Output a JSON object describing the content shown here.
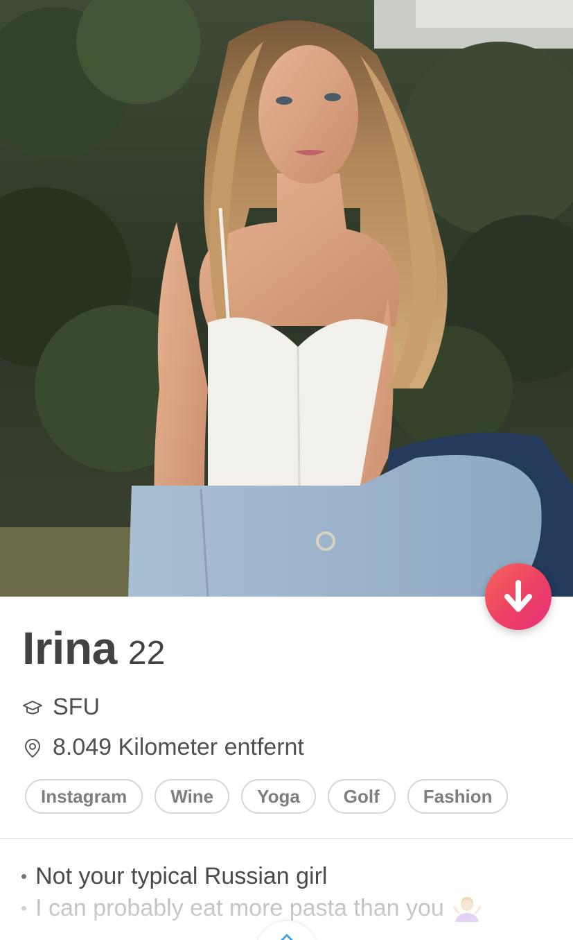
{
  "profile": {
    "name": "Irina",
    "age": "22",
    "school": "SFU",
    "distance": "8.049 Kilometer entfernt"
  },
  "interests": [
    "Instagram",
    "Wine",
    "Yoga",
    "Golf",
    "Fashion"
  ],
  "bio": [
    "Not your typical Russian girl",
    "I can probably eat more pasta than you"
  ],
  "icons": {
    "school": "graduation-cap-icon",
    "distance": "location-pin-icon",
    "collapse": "arrow-down-icon",
    "emoji": "person-shrugging-emoji"
  },
  "colors": {
    "accent_start": "#f7645a",
    "accent_end": "#e9327a",
    "text_primary": "#424242",
    "tag_border": "#d6d6d6"
  }
}
